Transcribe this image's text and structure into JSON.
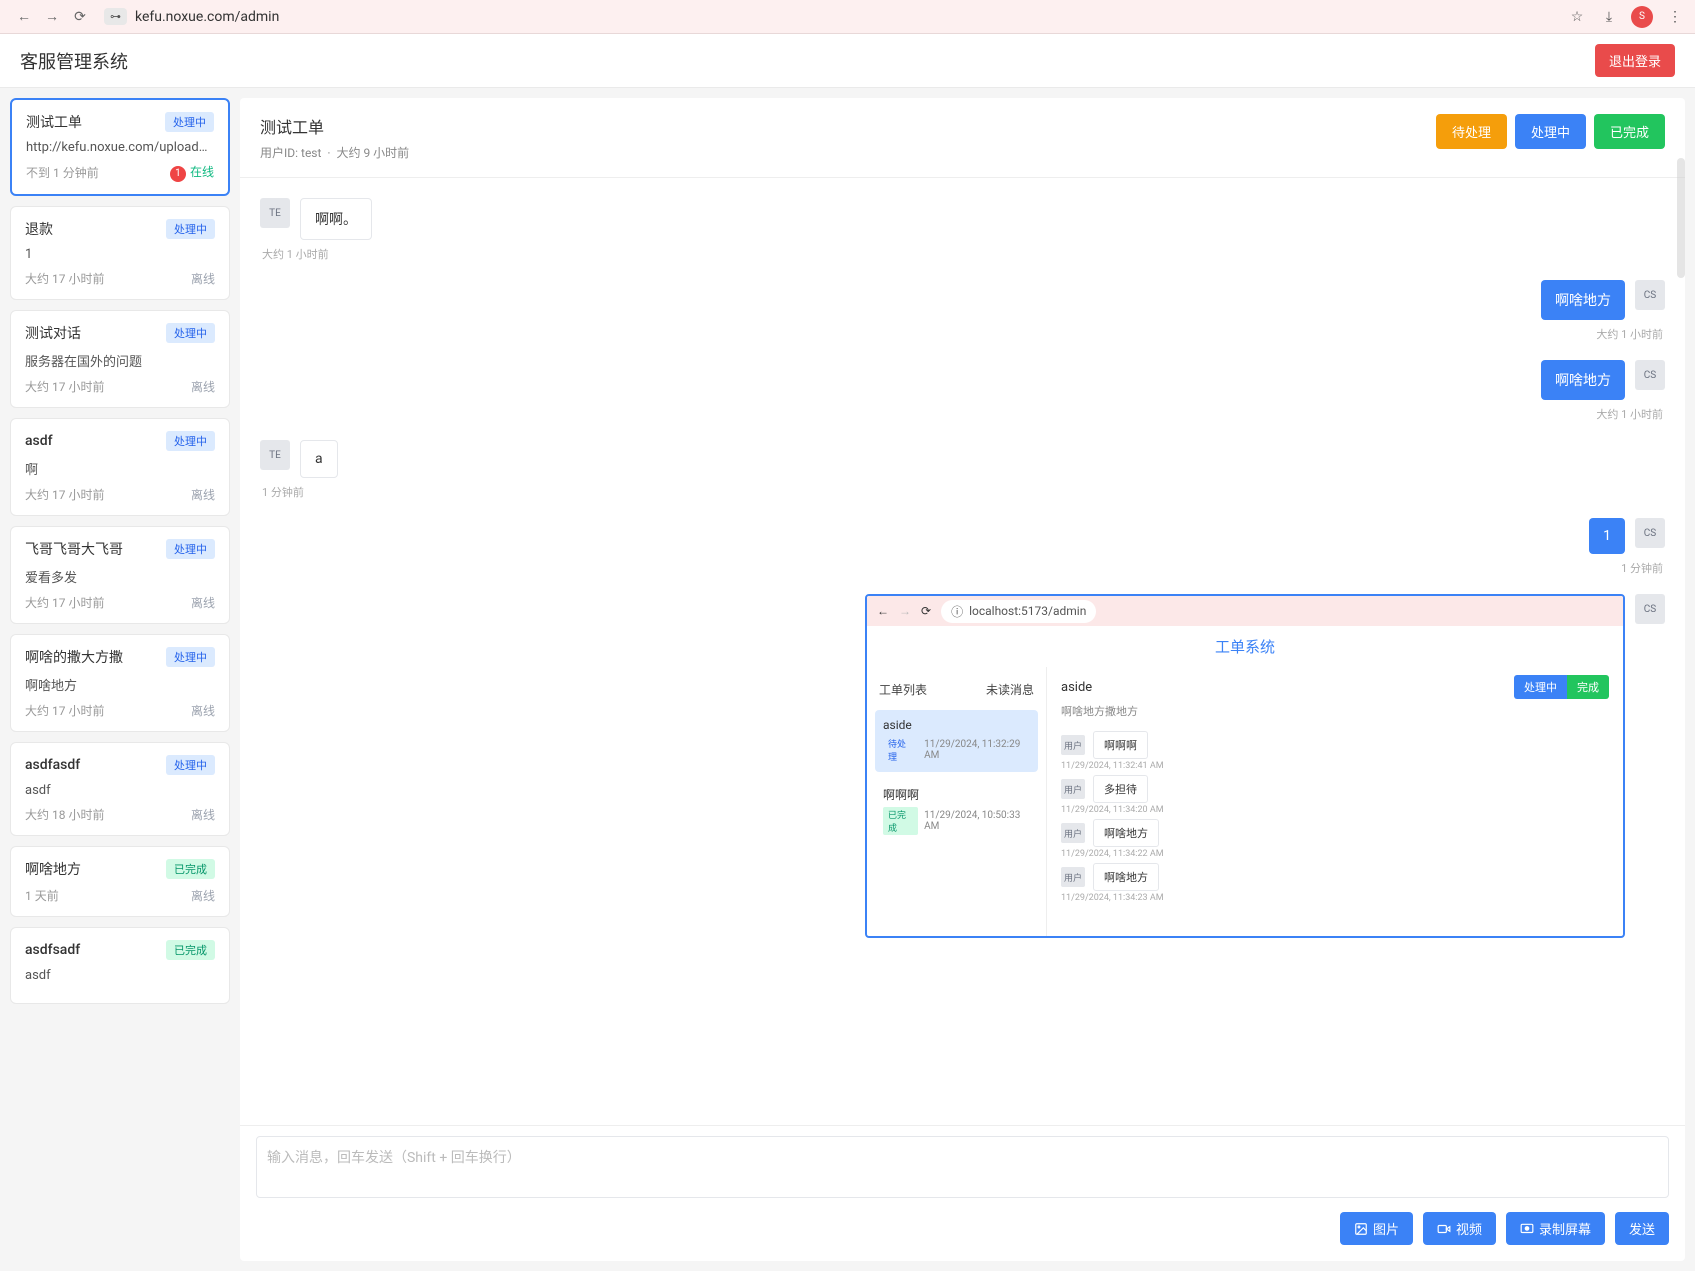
{
  "browser": {
    "url": "kefu.noxue.com/admin",
    "avatar_initials": "S"
  },
  "app": {
    "title": "客服管理系统",
    "logout": "退出登录"
  },
  "sidebar": {
    "tickets": [
      {
        "title": "测试工单",
        "status": "处理中",
        "status_class": "processing",
        "preview": "http://kefu.noxue.com/uploads/173...",
        "time": "不到 1 分钟前",
        "unread": "1",
        "presence": "在线",
        "presence_class": "online",
        "active": true
      },
      {
        "title": "退款",
        "status": "处理中",
        "status_class": "processing",
        "preview": "1",
        "time": "大约 17 小时前",
        "presence": "离线",
        "presence_class": "offline"
      },
      {
        "title": "测试对话",
        "status": "处理中",
        "status_class": "processing",
        "preview": "服务器在国外的问题",
        "time": "大约 17 小时前",
        "presence": "离线",
        "presence_class": "offline"
      },
      {
        "title": "asdf",
        "status": "处理中",
        "status_class": "processing",
        "preview": "啊",
        "time": "大约 17 小时前",
        "presence": "离线",
        "presence_class": "offline"
      },
      {
        "title": "飞哥飞哥大飞哥",
        "status": "处理中",
        "status_class": "processing",
        "preview": "爱看多发",
        "time": "大约 17 小时前",
        "presence": "离线",
        "presence_class": "offline"
      },
      {
        "title": "啊啥的撒大方撒",
        "status": "处理中",
        "status_class": "processing",
        "preview": "啊啥地方",
        "time": "大约 17 小时前",
        "presence": "离线",
        "presence_class": "offline"
      },
      {
        "title": "asdfasdf",
        "status": "处理中",
        "status_class": "processing",
        "preview": "asdf",
        "time": "大约 18 小时前",
        "presence": "离线",
        "presence_class": "offline"
      },
      {
        "title": "啊啥地方",
        "status": "已完成",
        "status_class": "done",
        "preview": "",
        "time": "1 天前",
        "presence": "离线",
        "presence_class": "offline"
      },
      {
        "title": "asdfsadf",
        "status": "已完成",
        "status_class": "done",
        "preview": "asdf",
        "time": "",
        "presence": "",
        "presence_class": ""
      }
    ]
  },
  "detail": {
    "title": "测试工单",
    "user_id": "用户ID: test",
    "separator": "·",
    "created": "大约 9 小时前",
    "status_buttons": {
      "pending": "待处理",
      "processing": "处理中",
      "done": "已完成"
    }
  },
  "messages": [
    {
      "side": "left",
      "avatar": "TE",
      "text": "啊啊。",
      "time": "大约 1 小时前"
    },
    {
      "side": "right",
      "avatar": "CS",
      "text": "啊啥地方",
      "time": "大约 1 小时前"
    },
    {
      "side": "right",
      "avatar": "CS",
      "text": "啊啥地方",
      "time": "大约 1 小时前"
    },
    {
      "side": "left",
      "avatar": "TE",
      "text": "a",
      "time": "1 分钟前"
    },
    {
      "side": "right",
      "avatar": "CS",
      "text": "1",
      "time": "1 分钟前"
    }
  ],
  "embedded": {
    "url": "localhost:5173/admin",
    "system_title": "工单系统",
    "left_header": "工单列表",
    "left_header_right": "未读消息",
    "tickets": [
      {
        "title": "aside",
        "badge": "待处理",
        "badge_class": "processing",
        "time": "11/29/2024, 11:32:29 AM",
        "active": true
      },
      {
        "title": "啊啊啊",
        "badge": "已完成",
        "badge_class": "done",
        "time": "11/29/2024, 10:50:33 AM"
      }
    ],
    "right": {
      "title": "aside",
      "btn_processing": "处理中",
      "btn_done": "完成",
      "subtitle": "啊啥地方撒地方",
      "msgs": [
        {
          "who": "用户",
          "text": "啊啊啊",
          "time": "11/29/2024, 11:32:41 AM"
        },
        {
          "who": "用户",
          "text": "多担待",
          "time": "11/29/2024, 11:34:20 AM"
        },
        {
          "who": "用户",
          "text": "啊啥地方",
          "time": "11/29/2024, 11:34:22 AM"
        },
        {
          "who": "用户",
          "text": "啊啥地方",
          "time": "11/29/2024, 11:34:23 AM"
        }
      ]
    },
    "right_avatar": "CS"
  },
  "composer": {
    "placeholder": "输入消息，回车发送（Shift + 回车换行）",
    "image": "图片",
    "video": "视频",
    "record": "录制屏幕",
    "send": "发送"
  }
}
